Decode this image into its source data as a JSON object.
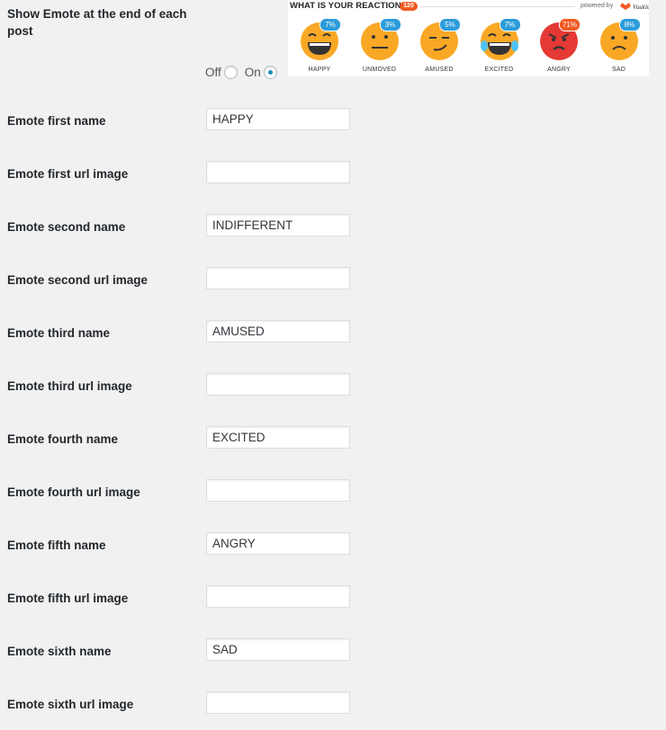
{
  "show_emote": {
    "label": "Show Emote at the end of each post",
    "off_label": "Off",
    "on_label": "On",
    "selected": "On"
  },
  "preview": {
    "title": "WHAT IS YOUR REACTION?",
    "count": "120",
    "powered_by": "powered by",
    "brand": "Vuukle",
    "emotes": [
      {
        "name": "HAPPY",
        "pct": "7%",
        "badge_color": "#2d9cdb",
        "icon": "laughing-face-icon"
      },
      {
        "name": "UNMOVED",
        "pct": "3%",
        "badge_color": "#2d9cdb",
        "icon": "neutral-face-icon"
      },
      {
        "name": "AMUSED",
        "pct": "5%",
        "badge_color": "#2d9cdb",
        "icon": "smirk-face-icon"
      },
      {
        "name": "EXCITED",
        "pct": "7%",
        "badge_color": "#2d9cdb",
        "icon": "tears-of-joy-face-icon"
      },
      {
        "name": "ANGRY",
        "pct": "71%",
        "badge_color": "#f15a24",
        "icon": "angry-face-icon"
      },
      {
        "name": "SAD",
        "pct": "8%",
        "badge_color": "#2d9cdb",
        "icon": "sad-face-icon"
      }
    ]
  },
  "fields": [
    {
      "label": "Emote first name",
      "value": "HAPPY"
    },
    {
      "label": "Emote first url image",
      "value": ""
    },
    {
      "label": "Emote second name",
      "value": "INDIFFERENT"
    },
    {
      "label": "Emote second url image",
      "value": ""
    },
    {
      "label": "Emote third name",
      "value": "AMUSED"
    },
    {
      "label": "Emote third url image",
      "value": ""
    },
    {
      "label": "Emote fourth name",
      "value": "EXCITED"
    },
    {
      "label": "Emote fourth url image",
      "value": ""
    },
    {
      "label": "Emote fifth name",
      "value": "ANGRY"
    },
    {
      "label": "Emote fifth url image",
      "value": ""
    },
    {
      "label": "Emote sixth name",
      "value": "SAD"
    },
    {
      "label": "Emote sixth url image",
      "value": ""
    }
  ]
}
